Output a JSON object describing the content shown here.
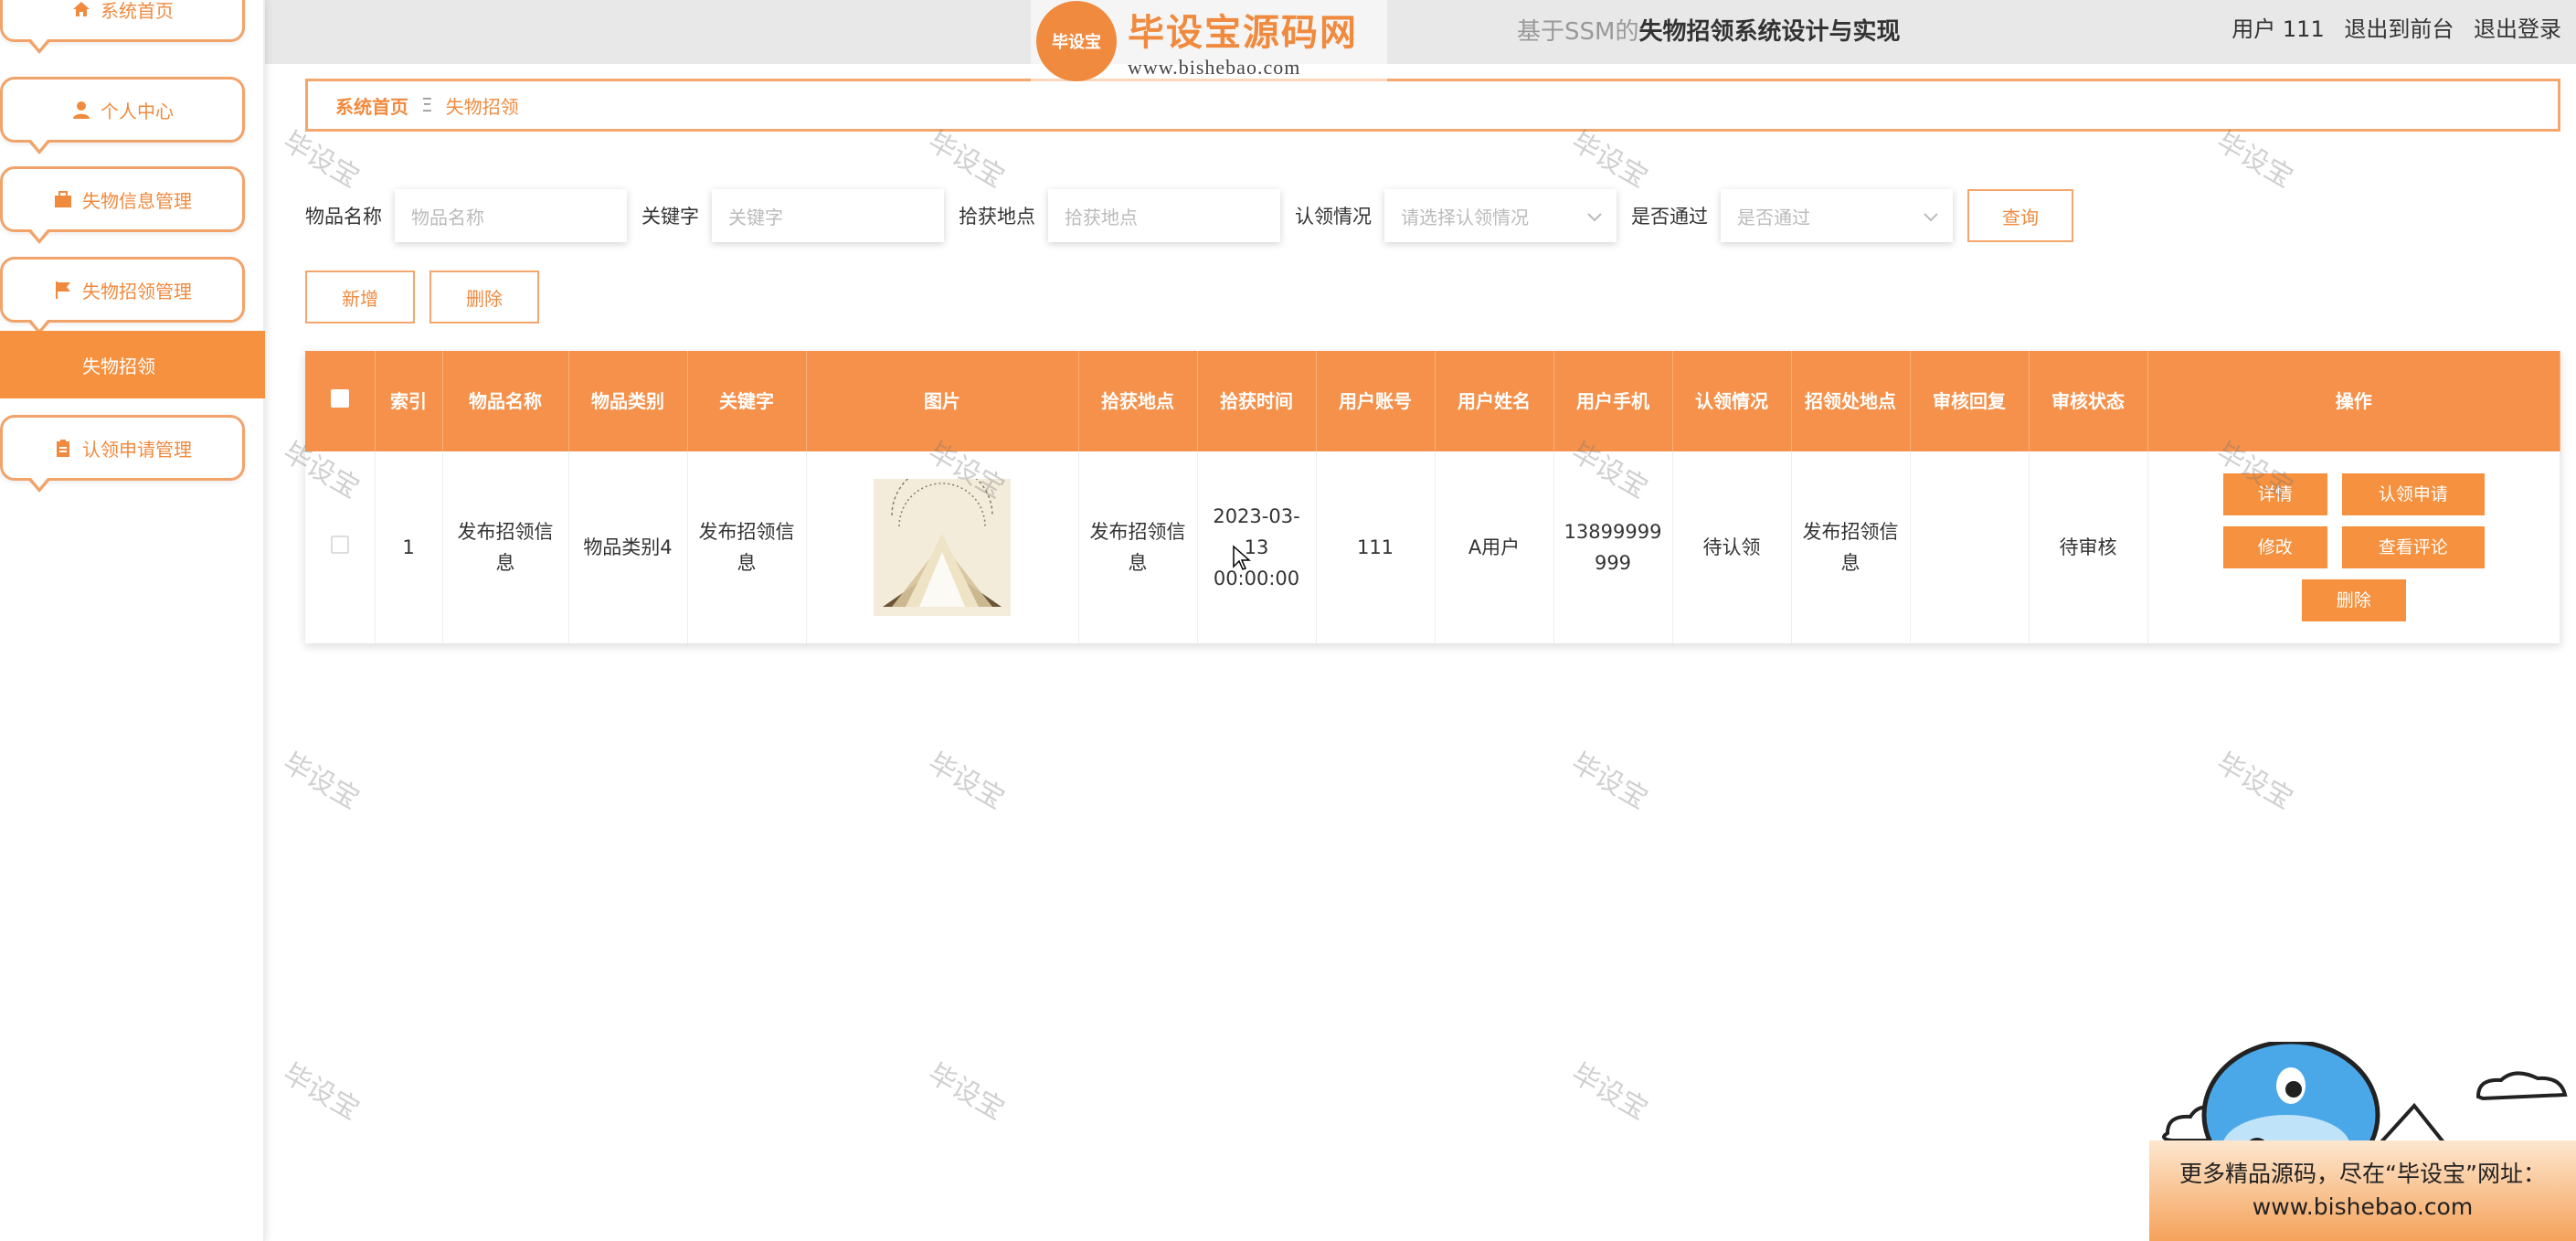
{
  "sidebar": {
    "items": [
      {
        "label": "系统首页",
        "icon": "home-icon"
      },
      {
        "label": "个人中心",
        "icon": "user-icon"
      },
      {
        "label": "失物信息管理",
        "icon": "briefcase-icon"
      },
      {
        "label": "失物招领管理",
        "icon": "flag-icon"
      },
      {
        "label": "认领申请管理",
        "icon": "clipboard-icon"
      }
    ],
    "active_sub": "失物招领"
  },
  "header": {
    "title_prefix": "基于SSM的",
    "title": "失物招领系统设计与实现",
    "user": "用户 111",
    "to_front": "退出到前台",
    "logout": "退出登录"
  },
  "logo": {
    "badge": "毕设宝",
    "name": "毕设宝源码网",
    "url": "www.bishebao.com"
  },
  "breadcrumb": {
    "home": "系统首页",
    "current": "失物招领"
  },
  "search": {
    "name_label": "物品名称",
    "name_placeholder": "物品名称",
    "keyword_label": "关键字",
    "keyword_placeholder": "关键字",
    "place_label": "拾获地点",
    "place_placeholder": "拾获地点",
    "claim_label": "认领情况",
    "claim_placeholder": "请选择认领情况",
    "pass_label": "是否通过",
    "pass_placeholder": "是否通过",
    "query": "查询"
  },
  "actions": {
    "add": "新增",
    "delete": "删除"
  },
  "table": {
    "headers": [
      "索引",
      "物品名称",
      "物品类别",
      "关键字",
      "图片",
      "拾获地点",
      "拾获时间",
      "用户账号",
      "用户姓名",
      "用户手机",
      "认领情况",
      "招领处地点",
      "审核回复",
      "审核状态",
      "操作"
    ],
    "rows": [
      {
        "index": "1",
        "name": "发布招领信息",
        "category": "物品类别4",
        "keyword": "发布招领信息",
        "place": "发布招领信息",
        "time": "2023-03-13 00:00:00",
        "account": "111",
        "username": "A用户",
        "phone": "13899999999",
        "claim": "待认领",
        "office": "发布招领信息",
        "reply": "",
        "status": "待审核",
        "ops": {
          "detail": "详情",
          "apply": "认领申请",
          "edit": "修改",
          "comments": "查看评论",
          "delete": "删除"
        }
      }
    ]
  },
  "watermark": "毕设宝",
  "promo": {
    "line1": "更多精品源码，尽在“毕设宝”网址：",
    "line2": "www.bishebao.com"
  },
  "colors": {
    "accent": "#f5913f",
    "border": "#f5a66c",
    "header_bg": "#e8e8e8"
  }
}
